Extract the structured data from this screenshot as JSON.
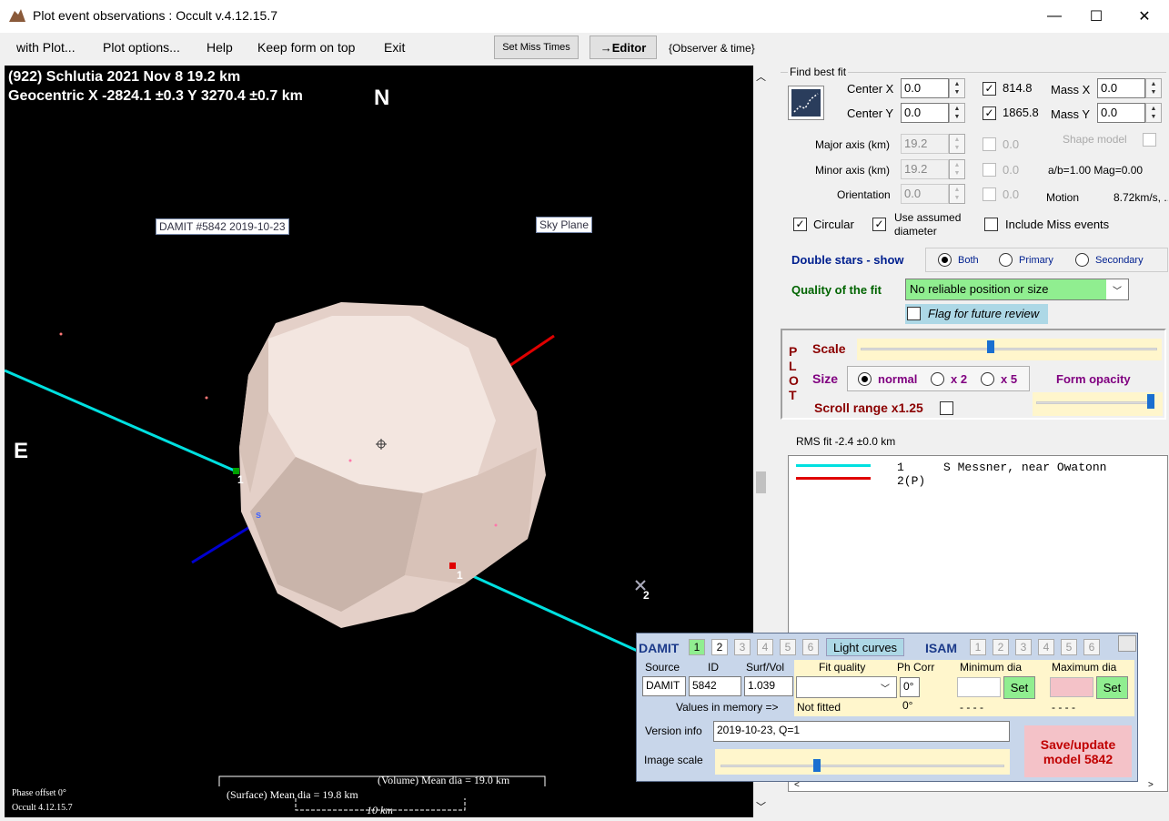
{
  "window": {
    "title": "Plot event observations : Occult v.4.12.15.7",
    "min": "—",
    "max": "☐",
    "close": "✕"
  },
  "menu": {
    "items": [
      "with Plot...",
      "Plot options...",
      "Help",
      "Keep form on top",
      "Exit"
    ],
    "set_miss": "Set Miss Times",
    "editor": "→Editor",
    "observer": "{Observer & time}"
  },
  "plot": {
    "title1": "(922) Schlutia  2021 Nov 8  19.2 km",
    "title2": "Geocentric X  -2824.1 ±0.3  Y 3270.4 ±0.7 km",
    "north": "N",
    "east": "E",
    "damit_tag": "DAMIT #5842 2019-10-23",
    "sky_tag": "Sky Plane",
    "chord_label_1a": "1",
    "chord_label_1b": "1",
    "chord_label_2": "2",
    "s_label": "s",
    "vol_dia": "(Volume) Mean dia = 19.0 km",
    "surf_dia": "(Surface) Mean dia = 19.8 km",
    "scale_bar": "10 km",
    "phase": "Phase offset 0°",
    "version": "Occult 4.12.15.7"
  },
  "fit": {
    "group": "Find best fit",
    "center_x_label": "Center X",
    "center_x": "0.0",
    "center_y_label": "Center Y",
    "center_y": "0.0",
    "chk1_val": "814.8",
    "chk2_val": "1865.8",
    "mass_x_label": "Mass X",
    "mass_x": "0.0",
    "mass_y_label": "Mass Y",
    "mass_y": "0.0",
    "major_label": "Major axis (km)",
    "major": "19.2",
    "minor_label": "Minor axis (km)",
    "minor": "19.2",
    "orient_label": "Orientation",
    "orient": "0.0",
    "dis1": "0.0",
    "dis2": "0.0",
    "dis3": "0.0",
    "shape_model": "Shape model",
    "ab_mag": "a/b=1.00 Mag=0.00",
    "motion_label": "Motion",
    "motion_val": "8.72km/s, ..",
    "circular": "Circular",
    "use_assumed": "Use assumed diameter",
    "include_miss": "Include Miss events"
  },
  "double": {
    "label": "Double stars - show",
    "both": "Both",
    "primary": "Primary",
    "secondary": "Secondary"
  },
  "quality": {
    "label": "Quality of the fit",
    "value": "No reliable position or size",
    "flag": "Flag for future review"
  },
  "plotbox": {
    "letters": "PLOT",
    "scale": "Scale",
    "size": "Size",
    "normal": "normal",
    "x2": "x 2",
    "x5": "x 5",
    "form_opacity": "Form opacity",
    "scroll_range": "Scroll range x1.25"
  },
  "rms": {
    "label": "RMS fit -2.4 ±0.0 km",
    "row1_num": "1",
    "row1_name": "S Messner, near Owatonn",
    "row2_num": "2(P)"
  },
  "damit": {
    "label": "DAMIT",
    "nums": [
      "1",
      "2",
      "3",
      "4",
      "5",
      "6"
    ],
    "light_curves": "Light curves",
    "isam": "ISAM",
    "source_h": "Source",
    "id_h": "ID",
    "surf_h": "Surf/Vol",
    "source": "DAMIT",
    "id": "5842",
    "surf": "1.039",
    "fitq_h": "Fit quality",
    "phcorr_h": "Ph Corr",
    "phcorr": "0°",
    "min_h": "Minimum dia",
    "max_h": "Maximum dia",
    "set": "Set",
    "mem_label": "Values in memory =>",
    "not_fitted": "Not fitted",
    "mem_ph": "0°",
    "mem_min": "- - - -",
    "mem_max": "- - - -",
    "version_label": "Version info",
    "version": "2019-10-23, Q=1",
    "image_scale": "Image scale",
    "save": "Save/update model 5842"
  },
  "colors": {
    "chord1": "#00e0e0",
    "chord2": "#e00000",
    "asteroid": "#ead9d0",
    "quality_bg": "#90ee90",
    "save_bg": "#f4c2c8",
    "damit_bg": "#c8d6ea"
  }
}
